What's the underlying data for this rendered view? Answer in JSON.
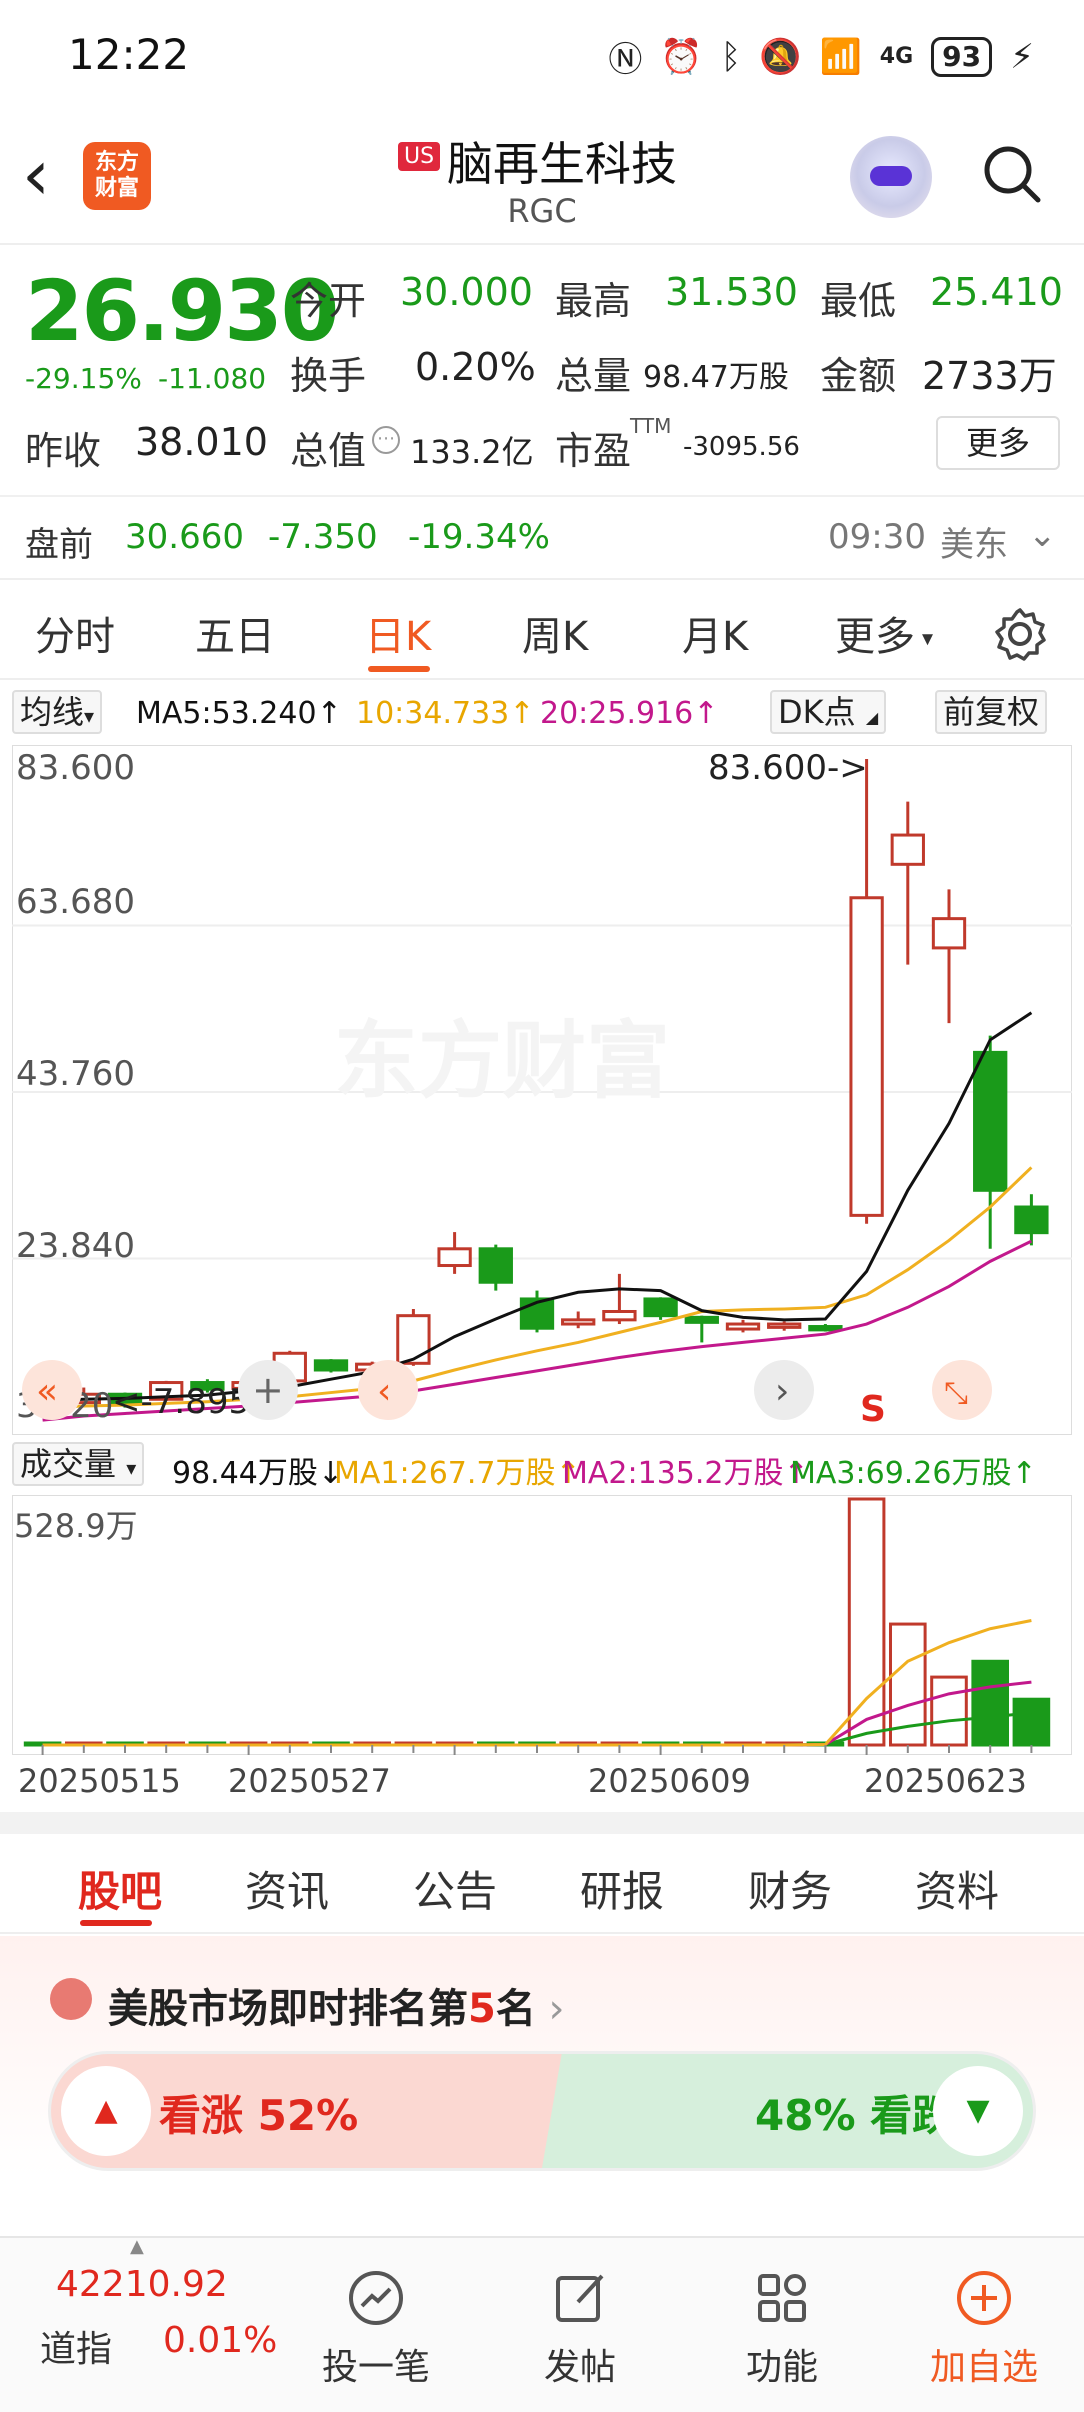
{
  "status_bar": {
    "time": "12:22",
    "battery": "93",
    "network": "4G"
  },
  "header": {
    "logo_line1": "东方",
    "logo_line2": "财富",
    "market_badge": "US",
    "stock_name": "脑再生科技",
    "stock_code": "RGC"
  },
  "quote": {
    "price": "26.930",
    "change_pct": "-29.15%",
    "change_abs": "-11.080",
    "prev_close_label": "昨收",
    "prev_close": "38.010",
    "open_label": "今开",
    "open": "30.000",
    "high_label": "最高",
    "high": "31.530",
    "low_label": "最低",
    "low": "25.410",
    "turnover_label": "换手",
    "turnover": "0.20%",
    "volume_label": "总量",
    "volume": "98.47万股",
    "amount_label": "金额",
    "amount": "2733万",
    "market_cap_label": "总值",
    "market_cap": "133.2亿",
    "pe_label": "市盈",
    "pe_sup": "TTM",
    "pe": "-3095.56",
    "more_label": "更多"
  },
  "premarket": {
    "label": "盘前",
    "price": "30.660",
    "change": "-7.350",
    "change_pct": "-19.34%",
    "time": "09:30",
    "zone": "美东"
  },
  "chart_tabs": [
    "分时",
    "五日",
    "日K",
    "周K",
    "月K",
    "更多"
  ],
  "active_chart_tab": "日K",
  "ma_row": {
    "selector": "均线",
    "ma5": "MA5:53.240↑",
    "ma10": "10:34.733↑",
    "ma20": "20:25.916↑",
    "dk_button": "DK点",
    "adjust_button": "前复权"
  },
  "price_axis": [
    "83.600",
    "63.680",
    "43.760",
    "23.840",
    "3.920"
  ],
  "annotations": {
    "high_marker": "83.600->",
    "low_marker": "<-7.895",
    "signal": "S",
    "watermark": "东方财富"
  },
  "volume_row": {
    "selector": "成交量",
    "current": "98.44万股↓",
    "ma1": "MA1:267.7万股↑",
    "ma2": "MA2:135.2万股↑",
    "ma3": "MA3:69.26万股↑",
    "max_label": "528.9万"
  },
  "date_axis": [
    "20250515",
    "20250527",
    "20250609",
    "20250623"
  ],
  "chart_data": {
    "type": "candlestick",
    "ylim": [
      3.92,
      83.6
    ],
    "candles": [
      {
        "o": 8.0,
        "c": 6.5,
        "h": 8.2,
        "l": 6.0
      },
      {
        "o": 6.6,
        "c": 7.6,
        "h": 8.4,
        "l": 6.2
      },
      {
        "o": 7.6,
        "c": 6.5,
        "h": 7.8,
        "l": 6.0
      },
      {
        "o": 7.0,
        "c": 9.0,
        "h": 9.2,
        "l": 6.8
      },
      {
        "o": 9.0,
        "c": 8.2,
        "h": 9.4,
        "l": 7.8
      },
      {
        "o": 8.3,
        "c": 9.0,
        "h": 9.3,
        "l": 8.0
      },
      {
        "o": 9.2,
        "c": 12.5,
        "h": 12.8,
        "l": 8.9
      },
      {
        "o": 11.6,
        "c": 10.5,
        "h": 11.8,
        "l": 10.2
      },
      {
        "o": 10.5,
        "c": 11.2,
        "h": 11.5,
        "l": 10.3
      },
      {
        "o": 11.3,
        "c": 17.0,
        "h": 17.8,
        "l": 11.0
      },
      {
        "o": 23.0,
        "c": 25.0,
        "h": 27.0,
        "l": 22.0
      },
      {
        "o": 25.0,
        "c": 21.0,
        "h": 25.5,
        "l": 20.0
      },
      {
        "o": 19.0,
        "c": 15.5,
        "h": 20.0,
        "l": 15.0
      },
      {
        "o": 16.0,
        "c": 16.5,
        "h": 17.5,
        "l": 15.5
      },
      {
        "o": 16.5,
        "c": 17.5,
        "h": 22.0,
        "l": 16.0
      },
      {
        "o": 19.0,
        "c": 17.0,
        "h": 19.2,
        "l": 16.5
      },
      {
        "o": 16.8,
        "c": 16.2,
        "h": 17.0,
        "l": 13.8
      },
      {
        "o": 15.4,
        "c": 16.0,
        "h": 16.5,
        "l": 15.0
      },
      {
        "o": 15.6,
        "c": 16.0,
        "h": 16.3,
        "l": 15.2
      },
      {
        "o": 15.7,
        "c": 15.3,
        "h": 16.0,
        "l": 15.1
      },
      {
        "o": 29.0,
        "c": 67.0,
        "h": 83.6,
        "l": 28.0
      },
      {
        "o": 71.0,
        "c": 74.5,
        "h": 78.5,
        "l": 59.0
      },
      {
        "o": 61.0,
        "c": 64.5,
        "h": 68.0,
        "l": 52.0
      },
      {
        "o": 48.5,
        "c": 32.0,
        "h": 50.5,
        "l": 25.0
      },
      {
        "o": 30.0,
        "c": 26.93,
        "h": 31.53,
        "l": 25.41
      }
    ],
    "ma5": [
      6.8,
      7.0,
      7.1,
      7.3,
      7.5,
      8.0,
      8.5,
      9.4,
      10.3,
      11.8,
      14.5,
      16.6,
      18.6,
      19.8,
      20.2,
      20.0,
      17.6,
      16.8,
      16.5,
      16.6,
      22.3,
      32.0,
      40.0,
      50.0,
      53.24
    ],
    "ma10": [
      6.0,
      6.2,
      6.3,
      6.5,
      6.7,
      7.0,
      7.3,
      7.8,
      8.3,
      9.2,
      10.5,
      11.7,
      12.8,
      13.8,
      15.0,
      16.2,
      17.5,
      17.7,
      17.8,
      18.0,
      19.5,
      22.5,
      26.0,
      30.0,
      34.733
    ],
    "ma20": [
      4.5,
      5.0,
      5.3,
      5.6,
      5.9,
      6.2,
      6.6,
      7.0,
      7.4,
      8.0,
      8.8,
      9.6,
      10.4,
      11.2,
      12.0,
      12.7,
      13.3,
      13.8,
      14.3,
      14.8,
      16.0,
      18.0,
      20.5,
      23.5,
      25.916
    ],
    "volume": [
      2,
      2,
      2,
      2,
      2,
      2,
      2,
      2,
      1,
      1,
      1,
      1,
      1,
      1,
      1,
      1,
      1,
      1,
      1,
      1,
      528.9,
      260,
      146,
      180,
      98.44
    ],
    "volume_up": [
      false,
      true,
      false,
      true,
      false,
      true,
      true,
      false,
      true,
      true,
      true,
      false,
      false,
      true,
      true,
      false,
      false,
      true,
      true,
      false,
      true,
      true,
      true,
      false,
      false
    ],
    "vol_ma1": [
      0,
      0,
      0,
      0,
      0,
      0,
      0,
      0,
      0,
      0,
      0,
      0,
      0,
      0,
      0,
      0,
      0,
      0,
      0,
      1,
      100,
      180,
      220,
      250,
      267.7
    ],
    "vol_ma2": [
      0,
      0,
      0,
      0,
      0,
      0,
      0,
      0,
      0,
      0,
      0,
      0,
      0,
      0,
      0,
      0,
      0,
      0,
      0,
      1,
      55,
      85,
      110,
      125,
      135.2
    ],
    "vol_ma3": [
      0,
      0,
      0,
      0,
      0,
      0,
      0,
      0,
      0,
      0,
      0,
      0,
      0,
      0,
      0,
      0,
      0,
      0,
      0,
      1,
      25,
      40,
      52,
      60,
      69.26
    ],
    "vol_ylim": [
      0,
      528.9
    ]
  },
  "news_tabs": [
    "股吧",
    "资讯",
    "公告",
    "研报",
    "财务",
    "资料"
  ],
  "active_news_tab": "股吧",
  "rank": {
    "prefix": "美股市场即时排名第",
    "rank": "5",
    "suffix": "名"
  },
  "vote": {
    "bull_label": "看涨 52%",
    "bear_label": "48% 看跌",
    "bull_pct": 52
  },
  "bottom_nav": {
    "index_value": "42210.92",
    "index_name": "道指",
    "index_change": "0.01%",
    "items": [
      "投一笔",
      "发帖",
      "功能",
      "加自选"
    ]
  },
  "colors": {
    "up": "#c0392b",
    "down": "#1a9a1a",
    "ma5": "#111111",
    "ma10": "#f0b020",
    "ma20": "#c2188c",
    "accent": "#f05a22"
  }
}
